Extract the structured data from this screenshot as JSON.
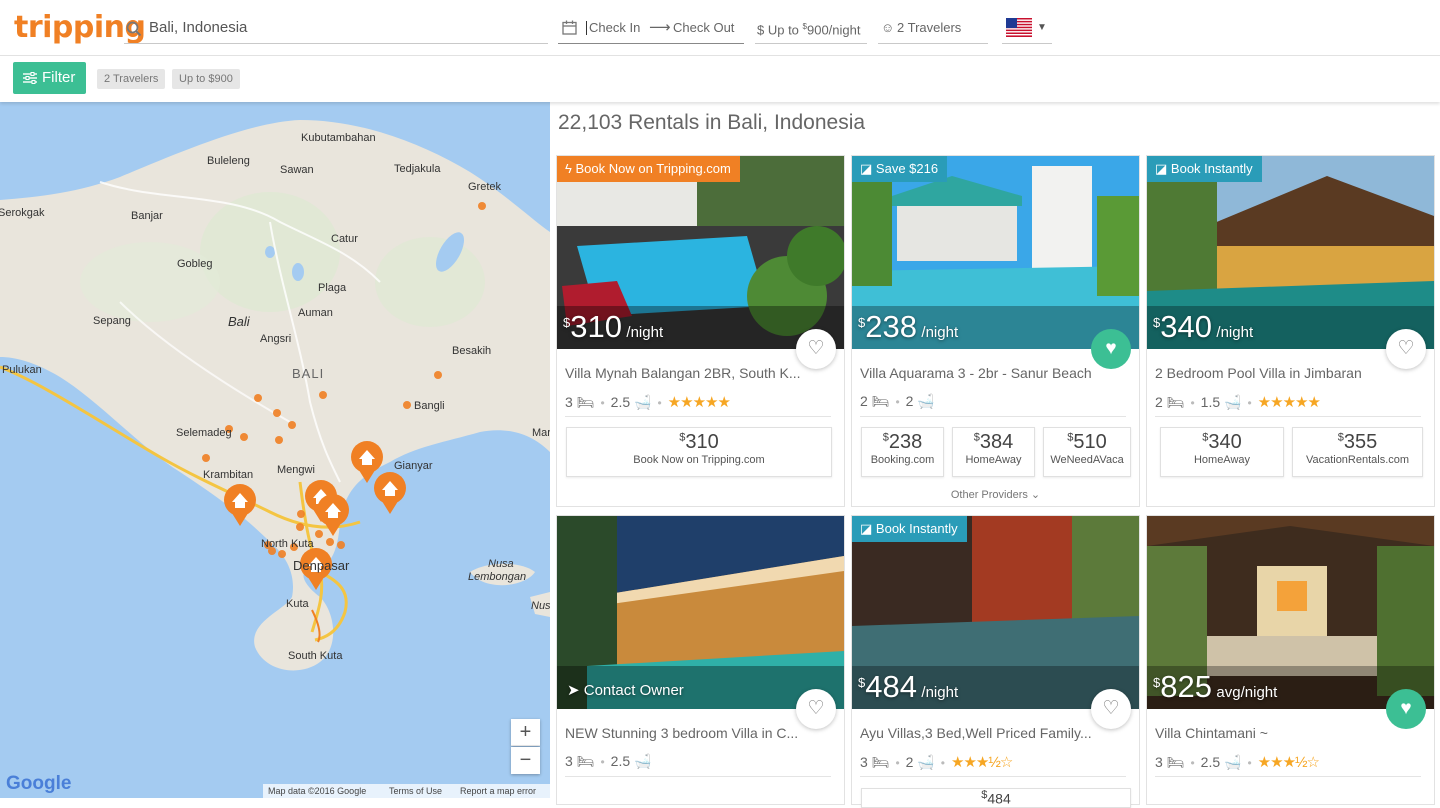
{
  "header": {
    "logo": "tripping",
    "search_value": "Bali, Indonesia",
    "checkin_placeholder": "Check In",
    "checkout_placeholder": "Check Out",
    "price_prefix": "$ Up to ",
    "price_cur": "$",
    "price_value": "900/night",
    "travelers": "2 Travelers",
    "flag_icon": "us-flag-icon"
  },
  "filters": {
    "filter_label": "Filter",
    "chips": [
      "2 Travelers",
      "Up to $900"
    ]
  },
  "map": {
    "labels": [
      "Kubutambahan",
      "Buleleng",
      "Sawan",
      "Tedjakula",
      "Gretek",
      "Serokgak",
      "Banjar",
      "Catur",
      "Gobleg",
      "Plaga",
      "Sepang",
      "Bali",
      "Auman",
      "Angsri",
      "Besakih",
      "Pulukan",
      "BALI",
      "Bangli",
      "Selemadeg",
      "Mar",
      "Mengwi",
      "Gianyar",
      "Krambitan",
      "North Kuta",
      "Denpasar",
      "Nusa",
      "Lembongan",
      "Nus",
      "Kuta",
      "South Kuta"
    ],
    "zoom_in": "+",
    "zoom_out": "−",
    "google": "Google",
    "footer": [
      "Map data ©2016 Google",
      "Terms of Use",
      "Report a map error"
    ]
  },
  "results": {
    "title": "22,103 Rentals in Bali, Indonesia",
    "cards": [
      {
        "badge": "Book Now on Tripping.com",
        "cur": "$",
        "price": "310",
        "unit": "/night",
        "title": "Villa Mynah Balangan 2BR, South K...",
        "beds": "3",
        "baths": "2.5",
        "stars": "★★★★★",
        "providers": [
          {
            "cur": "$",
            "price": "310",
            "name": "Book Now on Tripping.com"
          }
        ]
      },
      {
        "badge": "Save $216",
        "cur": "$",
        "price": "238",
        "unit": "/night",
        "title": "Villa Aquarama 3 - 2br - Sanur Beach",
        "beds": "2",
        "baths": "2",
        "providers": [
          {
            "cur": "$",
            "price": "238",
            "name": "Booking.com"
          },
          {
            "cur": "$",
            "price": "384",
            "name": "HomeAway"
          },
          {
            "cur": "$",
            "price": "510",
            "name": "WeNeedAVaca"
          }
        ],
        "other": "Other Providers ⌄"
      },
      {
        "badge": "Book Instantly",
        "cur": "$",
        "price": "340",
        "unit": "/night",
        "title": "2 Bedroom Pool Villa in Jimbaran",
        "beds": "2",
        "baths": "1.5",
        "stars": "★★★★★",
        "providers": [
          {
            "cur": "$",
            "price": "340",
            "name": "HomeAway"
          },
          {
            "cur": "$",
            "price": "355",
            "name": "VacationRentals.com"
          }
        ]
      },
      {
        "contact": "Contact Owner",
        "title": "NEW Stunning 3 bedroom Villa in C...",
        "beds": "3",
        "baths": "2.5"
      },
      {
        "badge": "Book Instantly",
        "cur": "$",
        "price": "484",
        "unit": "/night",
        "title": "Ayu Villas,3 Bed,Well Priced Family...",
        "beds": "3",
        "baths": "2",
        "stars": "★★★½☆",
        "providers": [
          {
            "cur": "$",
            "price": "484"
          }
        ]
      },
      {
        "cur": "$",
        "price": "825",
        "unit": "avg/night",
        "title": "Villa Chintamani ~",
        "beds": "3",
        "baths": "2.5",
        "stars": "★★★½☆"
      }
    ]
  },
  "colors": {
    "brand": "#f08024",
    "accent": "#3cbf94",
    "badge_blue": "#2a9cb8",
    "star": "#f6a623"
  }
}
